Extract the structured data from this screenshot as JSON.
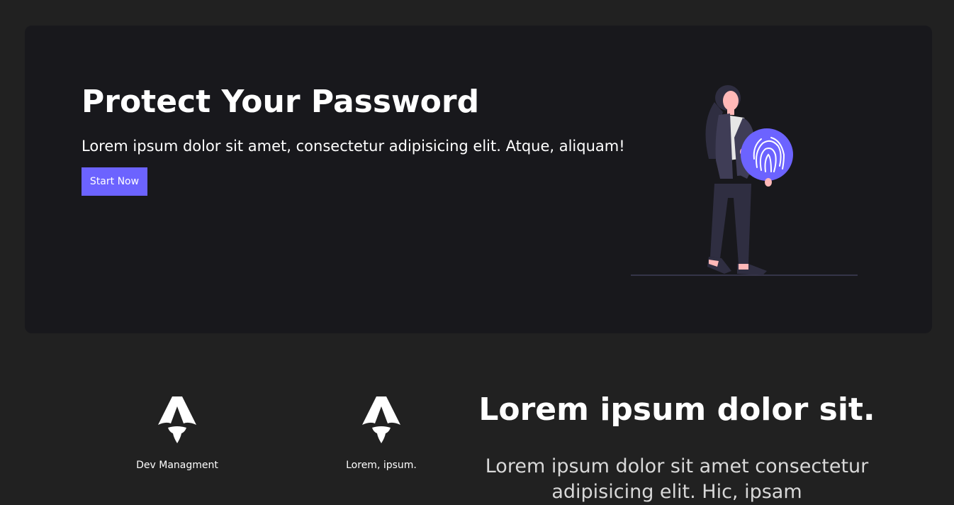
{
  "hero": {
    "title": "Protect Your Password",
    "subtitle": "Lorem ipsum dolor sit amet, consectetur adipisicing elit. Atque, aliquam!",
    "button_label": "Start Now",
    "illustration": "person-holding-fingerprint-illustration"
  },
  "features": [
    {
      "icon": "rocket-logo-icon",
      "label": "Dev Managment"
    },
    {
      "icon": "rocket-logo-icon",
      "label": "Lorem, ipsum."
    }
  ],
  "promo": {
    "title": "Lorem ipsum dolor sit.",
    "text_line1": "Lorem ipsum dolor sit amet consectetur",
    "text_line2": "adipisicing elit. Hic, ipsam"
  },
  "colors": {
    "page_bg": "#212121",
    "hero_bg": "#18181c",
    "accent": "#6c63ff"
  }
}
